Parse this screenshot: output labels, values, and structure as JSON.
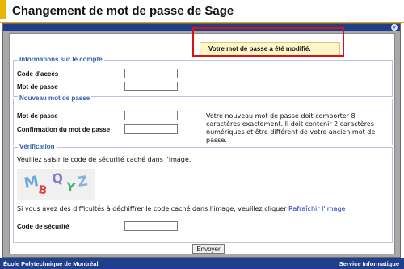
{
  "page": {
    "title": "Changement de mot de passe de Sage"
  },
  "status": {
    "message": "Votre mot de passe a été modifié."
  },
  "compte": {
    "legend": "Informations sur le compte",
    "code_acces_label": "Code d'accès",
    "code_acces_value": "",
    "mot_de_passe_label": "Mot de passe",
    "mot_de_passe_value": ""
  },
  "nouveau": {
    "legend": "Nouveau mot de passe",
    "mot_de_passe_label": "Mot de passe",
    "confirmation_label": "Confirmation du mot de passe",
    "help_text": "Votre nouveau mot de passe doit comporter 8 caractères exactement. Il doit contenir 2 caractères numériques et être différent de votre ancien mot de passe."
  },
  "verification": {
    "legend": "Vérification",
    "instruction": "Veuillez saisir le code de sécurité caché dans l'image.",
    "captcha_chars": [
      "M",
      "B",
      "Q",
      "Y",
      "Z"
    ],
    "captcha_colors": [
      "#6aa8d8",
      "#e04040",
      "#8a7bd0",
      "#4ab080",
      "#8ab0e0"
    ],
    "difficulty_text": "Si vous avez des difficultés à déchiffrer le code caché dans l'image, veuillez cliquer ",
    "refresh_link": "Rafraîchir l'image",
    "code_label": "Code de sécurité"
  },
  "actions": {
    "submit_label": "Envoyer"
  },
  "footer": {
    "left": "École Polytechnique de Montréal",
    "right": "Service Informatique"
  }
}
